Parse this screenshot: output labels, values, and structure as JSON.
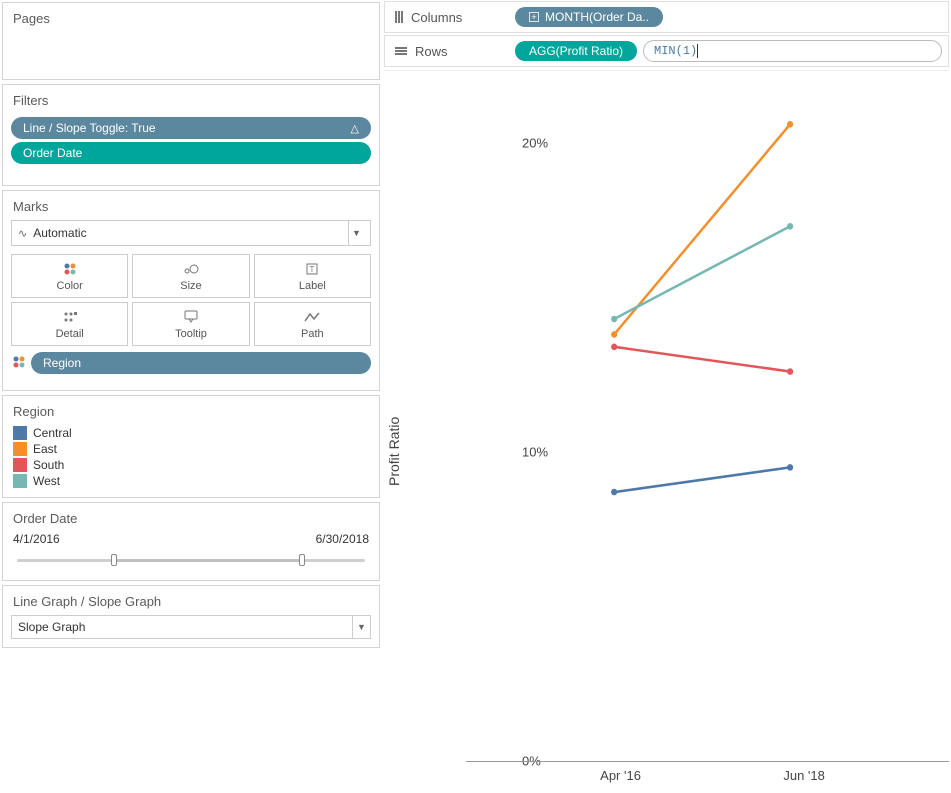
{
  "panels": {
    "pages_title": "Pages",
    "filters_title": "Filters",
    "marks_title": "Marks",
    "legend_title": "Region",
    "order_date_title": "Order Date",
    "param_title": "Line Graph / Slope Graph"
  },
  "filters": {
    "pill1": "Line / Slope Toggle: True",
    "pill2": "Order Date"
  },
  "marks": {
    "type": "Automatic",
    "buttons": {
      "color": "Color",
      "size": "Size",
      "label": "Label",
      "detail": "Detail",
      "tooltip": "Tooltip",
      "path": "Path"
    },
    "region_pill": "Region"
  },
  "legend_items": [
    {
      "label": "Central",
      "color": "#4e79a7"
    },
    {
      "label": "East",
      "color": "#f28e2b"
    },
    {
      "label": "South",
      "color": "#e15759"
    },
    {
      "label": "West",
      "color": "#76b7b2"
    }
  ],
  "order_date": {
    "start": "4/1/2016",
    "end": "6/30/2018",
    "start_pct": 27,
    "end_pct": 81
  },
  "param": {
    "value": "Slope Graph"
  },
  "shelves": {
    "columns_label": "Columns",
    "rows_label": "Rows",
    "columns_pill": "MONTH(Order Da..",
    "rows_pill": "AGG(Profit Ratio)",
    "calc_text": "MIN(1)"
  },
  "chart_data": {
    "type": "line",
    "title": "",
    "xlabel": "",
    "ylabel": "Profit Ratio",
    "categories": [
      "Apr '16",
      "Jun '18"
    ],
    "ylim": [
      0,
      0.22
    ],
    "yticks": [
      0,
      0.1,
      0.2
    ],
    "ytick_labels": [
      "0%",
      "10%",
      "20%"
    ],
    "series": [
      {
        "name": "Central",
        "color": "#4e79a7",
        "values": [
          0.087,
          0.095
        ]
      },
      {
        "name": "East",
        "color": "#f28e2b",
        "values": [
          0.138,
          0.206
        ]
      },
      {
        "name": "South",
        "color": "#e15759",
        "values": [
          0.134,
          0.126
        ]
      },
      {
        "name": "West",
        "color": "#76b7b2",
        "values": [
          0.143,
          0.173
        ]
      }
    ]
  }
}
